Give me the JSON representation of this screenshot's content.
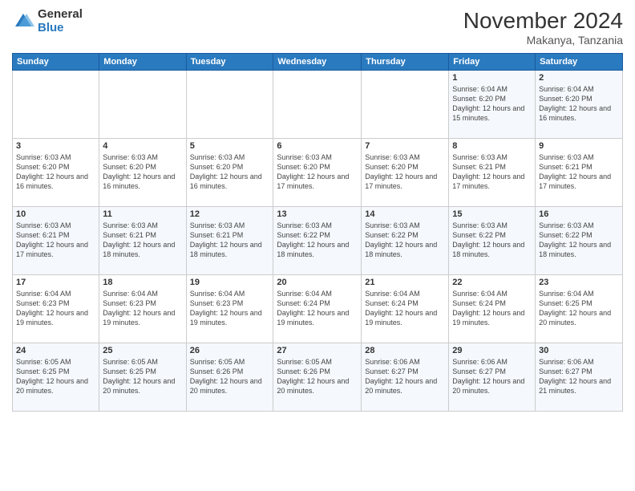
{
  "logo": {
    "general": "General",
    "blue": "Blue"
  },
  "title": {
    "month": "November 2024",
    "location": "Makanya, Tanzania"
  },
  "weekdays": [
    "Sunday",
    "Monday",
    "Tuesday",
    "Wednesday",
    "Thursday",
    "Friday",
    "Saturday"
  ],
  "weeks": [
    [
      {
        "day": "",
        "info": ""
      },
      {
        "day": "",
        "info": ""
      },
      {
        "day": "",
        "info": ""
      },
      {
        "day": "",
        "info": ""
      },
      {
        "day": "",
        "info": ""
      },
      {
        "day": "1",
        "info": "Sunrise: 6:04 AM\nSunset: 6:20 PM\nDaylight: 12 hours\nand 15 minutes."
      },
      {
        "day": "2",
        "info": "Sunrise: 6:04 AM\nSunset: 6:20 PM\nDaylight: 12 hours\nand 16 minutes."
      }
    ],
    [
      {
        "day": "3",
        "info": "Sunrise: 6:03 AM\nSunset: 6:20 PM\nDaylight: 12 hours\nand 16 minutes."
      },
      {
        "day": "4",
        "info": "Sunrise: 6:03 AM\nSunset: 6:20 PM\nDaylight: 12 hours\nand 16 minutes."
      },
      {
        "day": "5",
        "info": "Sunrise: 6:03 AM\nSunset: 6:20 PM\nDaylight: 12 hours\nand 16 minutes."
      },
      {
        "day": "6",
        "info": "Sunrise: 6:03 AM\nSunset: 6:20 PM\nDaylight: 12 hours\nand 17 minutes."
      },
      {
        "day": "7",
        "info": "Sunrise: 6:03 AM\nSunset: 6:20 PM\nDaylight: 12 hours\nand 17 minutes."
      },
      {
        "day": "8",
        "info": "Sunrise: 6:03 AM\nSunset: 6:21 PM\nDaylight: 12 hours\nand 17 minutes."
      },
      {
        "day": "9",
        "info": "Sunrise: 6:03 AM\nSunset: 6:21 PM\nDaylight: 12 hours\nand 17 minutes."
      }
    ],
    [
      {
        "day": "10",
        "info": "Sunrise: 6:03 AM\nSunset: 6:21 PM\nDaylight: 12 hours\nand 17 minutes."
      },
      {
        "day": "11",
        "info": "Sunrise: 6:03 AM\nSunset: 6:21 PM\nDaylight: 12 hours\nand 18 minutes."
      },
      {
        "day": "12",
        "info": "Sunrise: 6:03 AM\nSunset: 6:21 PM\nDaylight: 12 hours\nand 18 minutes."
      },
      {
        "day": "13",
        "info": "Sunrise: 6:03 AM\nSunset: 6:22 PM\nDaylight: 12 hours\nand 18 minutes."
      },
      {
        "day": "14",
        "info": "Sunrise: 6:03 AM\nSunset: 6:22 PM\nDaylight: 12 hours\nand 18 minutes."
      },
      {
        "day": "15",
        "info": "Sunrise: 6:03 AM\nSunset: 6:22 PM\nDaylight: 12 hours\nand 18 minutes."
      },
      {
        "day": "16",
        "info": "Sunrise: 6:03 AM\nSunset: 6:22 PM\nDaylight: 12 hours\nand 18 minutes."
      }
    ],
    [
      {
        "day": "17",
        "info": "Sunrise: 6:04 AM\nSunset: 6:23 PM\nDaylight: 12 hours\nand 19 minutes."
      },
      {
        "day": "18",
        "info": "Sunrise: 6:04 AM\nSunset: 6:23 PM\nDaylight: 12 hours\nand 19 minutes."
      },
      {
        "day": "19",
        "info": "Sunrise: 6:04 AM\nSunset: 6:23 PM\nDaylight: 12 hours\nand 19 minutes."
      },
      {
        "day": "20",
        "info": "Sunrise: 6:04 AM\nSunset: 6:24 PM\nDaylight: 12 hours\nand 19 minutes."
      },
      {
        "day": "21",
        "info": "Sunrise: 6:04 AM\nSunset: 6:24 PM\nDaylight: 12 hours\nand 19 minutes."
      },
      {
        "day": "22",
        "info": "Sunrise: 6:04 AM\nSunset: 6:24 PM\nDaylight: 12 hours\nand 19 minutes."
      },
      {
        "day": "23",
        "info": "Sunrise: 6:04 AM\nSunset: 6:25 PM\nDaylight: 12 hours\nand 20 minutes."
      }
    ],
    [
      {
        "day": "24",
        "info": "Sunrise: 6:05 AM\nSunset: 6:25 PM\nDaylight: 12 hours\nand 20 minutes."
      },
      {
        "day": "25",
        "info": "Sunrise: 6:05 AM\nSunset: 6:25 PM\nDaylight: 12 hours\nand 20 minutes."
      },
      {
        "day": "26",
        "info": "Sunrise: 6:05 AM\nSunset: 6:26 PM\nDaylight: 12 hours\nand 20 minutes."
      },
      {
        "day": "27",
        "info": "Sunrise: 6:05 AM\nSunset: 6:26 PM\nDaylight: 12 hours\nand 20 minutes."
      },
      {
        "day": "28",
        "info": "Sunrise: 6:06 AM\nSunset: 6:27 PM\nDaylight: 12 hours\nand 20 minutes."
      },
      {
        "day": "29",
        "info": "Sunrise: 6:06 AM\nSunset: 6:27 PM\nDaylight: 12 hours\nand 20 minutes."
      },
      {
        "day": "30",
        "info": "Sunrise: 6:06 AM\nSunset: 6:27 PM\nDaylight: 12 hours\nand 21 minutes."
      }
    ]
  ]
}
